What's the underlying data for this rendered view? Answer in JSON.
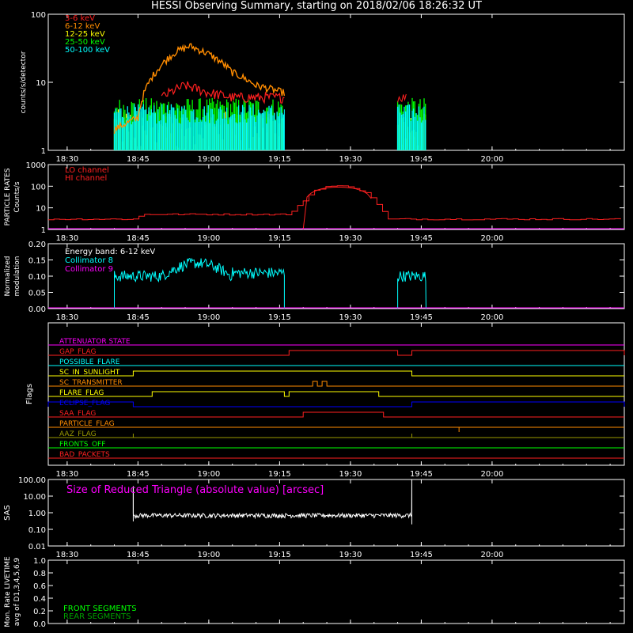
{
  "title": "HESSI Observing Summary, starting on 2018/02/06 18:26:32 UT",
  "colors": {
    "orange": "#ff8c00",
    "red": "#ff2020",
    "yellow": "#ffff00",
    "green": "#00ff00",
    "cyan": "#00ffff",
    "magenta": "#ff00ff",
    "blue": "#0000ff",
    "white": "#ffffff",
    "olive": "#9a9a00",
    "front_green": "#00ff00",
    "rear_green": "#00a000"
  },
  "chart_data": [
    {
      "id": "count-rates",
      "type": "line",
      "ylabel": "counts/s/detector",
      "yscale": "log",
      "ylim": [
        1,
        100
      ],
      "yticks": [
        "1",
        "10",
        "100"
      ],
      "xlim_minutes_from_1826": [
        0,
        122
      ],
      "xticks": [
        "18:30",
        "18:45",
        "19:00",
        "19:15",
        "19:30",
        "19:45",
        "20:00"
      ],
      "legend": [
        {
          "name": "3-6 keV",
          "color": "#ff2020"
        },
        {
          "name": "6-12 keV",
          "color": "#ff8c00"
        },
        {
          "name": "12-25 keV",
          "color": "#ffff00"
        },
        {
          "name": "25-50 keV",
          "color": "#00ff00"
        },
        {
          "name": "50-100 keV",
          "color": "#00ffff"
        }
      ],
      "series": [
        {
          "name": "6-12 keV",
          "x": [
            "18:40",
            "18:45",
            "18:50",
            "18:53",
            "18:56",
            "19:00",
            "19:05",
            "19:10",
            "19:16"
          ],
          "values": [
            2,
            3,
            18,
            28,
            34,
            26,
            14,
            9,
            7
          ]
        },
        {
          "name": "3-6 keV",
          "x": [
            "18:50",
            "18:55",
            "19:00",
            "19:05",
            "19:10",
            "19:16"
          ],
          "values": [
            6,
            9,
            7,
            6,
            6,
            6
          ]
        }
      ]
    },
    {
      "id": "particle-rates",
      "type": "line",
      "ylabel": "PARTICLE RATES Counts/s",
      "yscale": "log",
      "ylim": [
        1,
        1000
      ],
      "yticks": [
        "1",
        "10",
        "100",
        "1000"
      ],
      "xticks": [
        "18:30",
        "18:45",
        "19:00",
        "19:15",
        "19:30",
        "19:45",
        "20:00"
      ],
      "legend": [
        {
          "name": "LO channel",
          "color": "#ff2020"
        },
        {
          "name": "HI channel",
          "color": "#ff2020"
        }
      ],
      "series": [
        {
          "name": "LO channel",
          "x": [
            "18:26",
            "18:44",
            "18:46",
            "19:17",
            "19:22",
            "19:25",
            "19:30",
            "19:34",
            "19:38",
            "20:06"
          ],
          "values": [
            3,
            3,
            5,
            5,
            60,
            100,
            100,
            40,
            3,
            3
          ]
        }
      ]
    },
    {
      "id": "modulation",
      "type": "line",
      "ylabel": "Normalized modulation",
      "ylim": [
        0,
        0.2
      ],
      "yticks": [
        "0.00",
        "0.05",
        "0.10",
        "0.15",
        "0.20"
      ],
      "xticks": [
        "18:30",
        "18:45",
        "19:00",
        "19:15",
        "19:30",
        "19:45",
        "20:00"
      ],
      "legend": [
        {
          "name": "Energy band: 6-12 keV",
          "color": "#ffffff"
        },
        {
          "name": "Collimator 8",
          "color": "#00ffff"
        },
        {
          "name": "Collimator 9",
          "color": "#ff00ff"
        }
      ],
      "series": [
        {
          "name": "Collimator 8",
          "x": [
            "18:40",
            "18:50",
            "18:55",
            "19:00",
            "19:10",
            "19:16",
            "19:40",
            "19:46"
          ],
          "values": [
            0.1,
            0.12,
            0.15,
            0.13,
            0.11,
            0.11,
            0.1,
            0.1
          ]
        }
      ]
    },
    {
      "id": "flags",
      "type": "table",
      "ylabel": "Flags",
      "xticks": [
        "18:30",
        "18:45",
        "19:00",
        "19:15",
        "19:30",
        "19:45",
        "20:00"
      ],
      "flags": [
        {
          "name": "ATTENUATOR STATE",
          "color": "#ff00ff"
        },
        {
          "name": "GAP_FLAG",
          "color": "#ff2020"
        },
        {
          "name": "POSSIBLE_FLARE",
          "color": "#00ffff"
        },
        {
          "name": "SC_IN_SUNLIGHT",
          "color": "#ffff00"
        },
        {
          "name": "SC_TRANSMITTER",
          "color": "#ff8c00"
        },
        {
          "name": "FLARE_FLAG",
          "color": "#ffff00"
        },
        {
          "name": "ECLIPSE_FLAG",
          "color": "#0000ff"
        },
        {
          "name": "SAA_FLAG",
          "color": "#ff2020"
        },
        {
          "name": "PARTICLE_FLAG",
          "color": "#ff8c00"
        },
        {
          "name": "AAZ_FLAG",
          "color": "#9a9a00"
        },
        {
          "name": "FRONTS_OFF",
          "color": "#00ff00"
        },
        {
          "name": "BAD_PACKETS",
          "color": "#ff2020"
        }
      ]
    },
    {
      "id": "sas",
      "type": "line",
      "ylabel": "SAS",
      "yscale": "log",
      "ylim": [
        0.01,
        100
      ],
      "yticks": [
        "0.01",
        "0.10",
        "1.00",
        "10.00",
        "100.00"
      ],
      "xticks": [
        "18:30",
        "18:45",
        "19:00",
        "19:15",
        "19:30",
        "19:45",
        "20:00"
      ],
      "annotation": "Size of Reduced Triangle (absolute value) [arcsec]",
      "series": [
        {
          "name": "SAS",
          "x": [
            "18:44",
            "18:46",
            "19:00",
            "19:30",
            "19:43"
          ],
          "values": [
            10,
            0.7,
            0.7,
            0.75,
            0.8
          ]
        }
      ]
    },
    {
      "id": "livetime",
      "type": "line",
      "ylabel": "Mon. Rate LIVETIME avg of D1,3,4,5,6,9",
      "ylim": [
        0,
        1.0
      ],
      "yticks": [
        "0.0",
        "0.2",
        "0.4",
        "0.6",
        "0.8",
        "1.0"
      ],
      "legend": [
        {
          "name": "FRONT SEGMENTS",
          "color": "#00ff00"
        },
        {
          "name": "REAR SEGMENTS",
          "color": "#00a000"
        }
      ],
      "series": []
    }
  ]
}
